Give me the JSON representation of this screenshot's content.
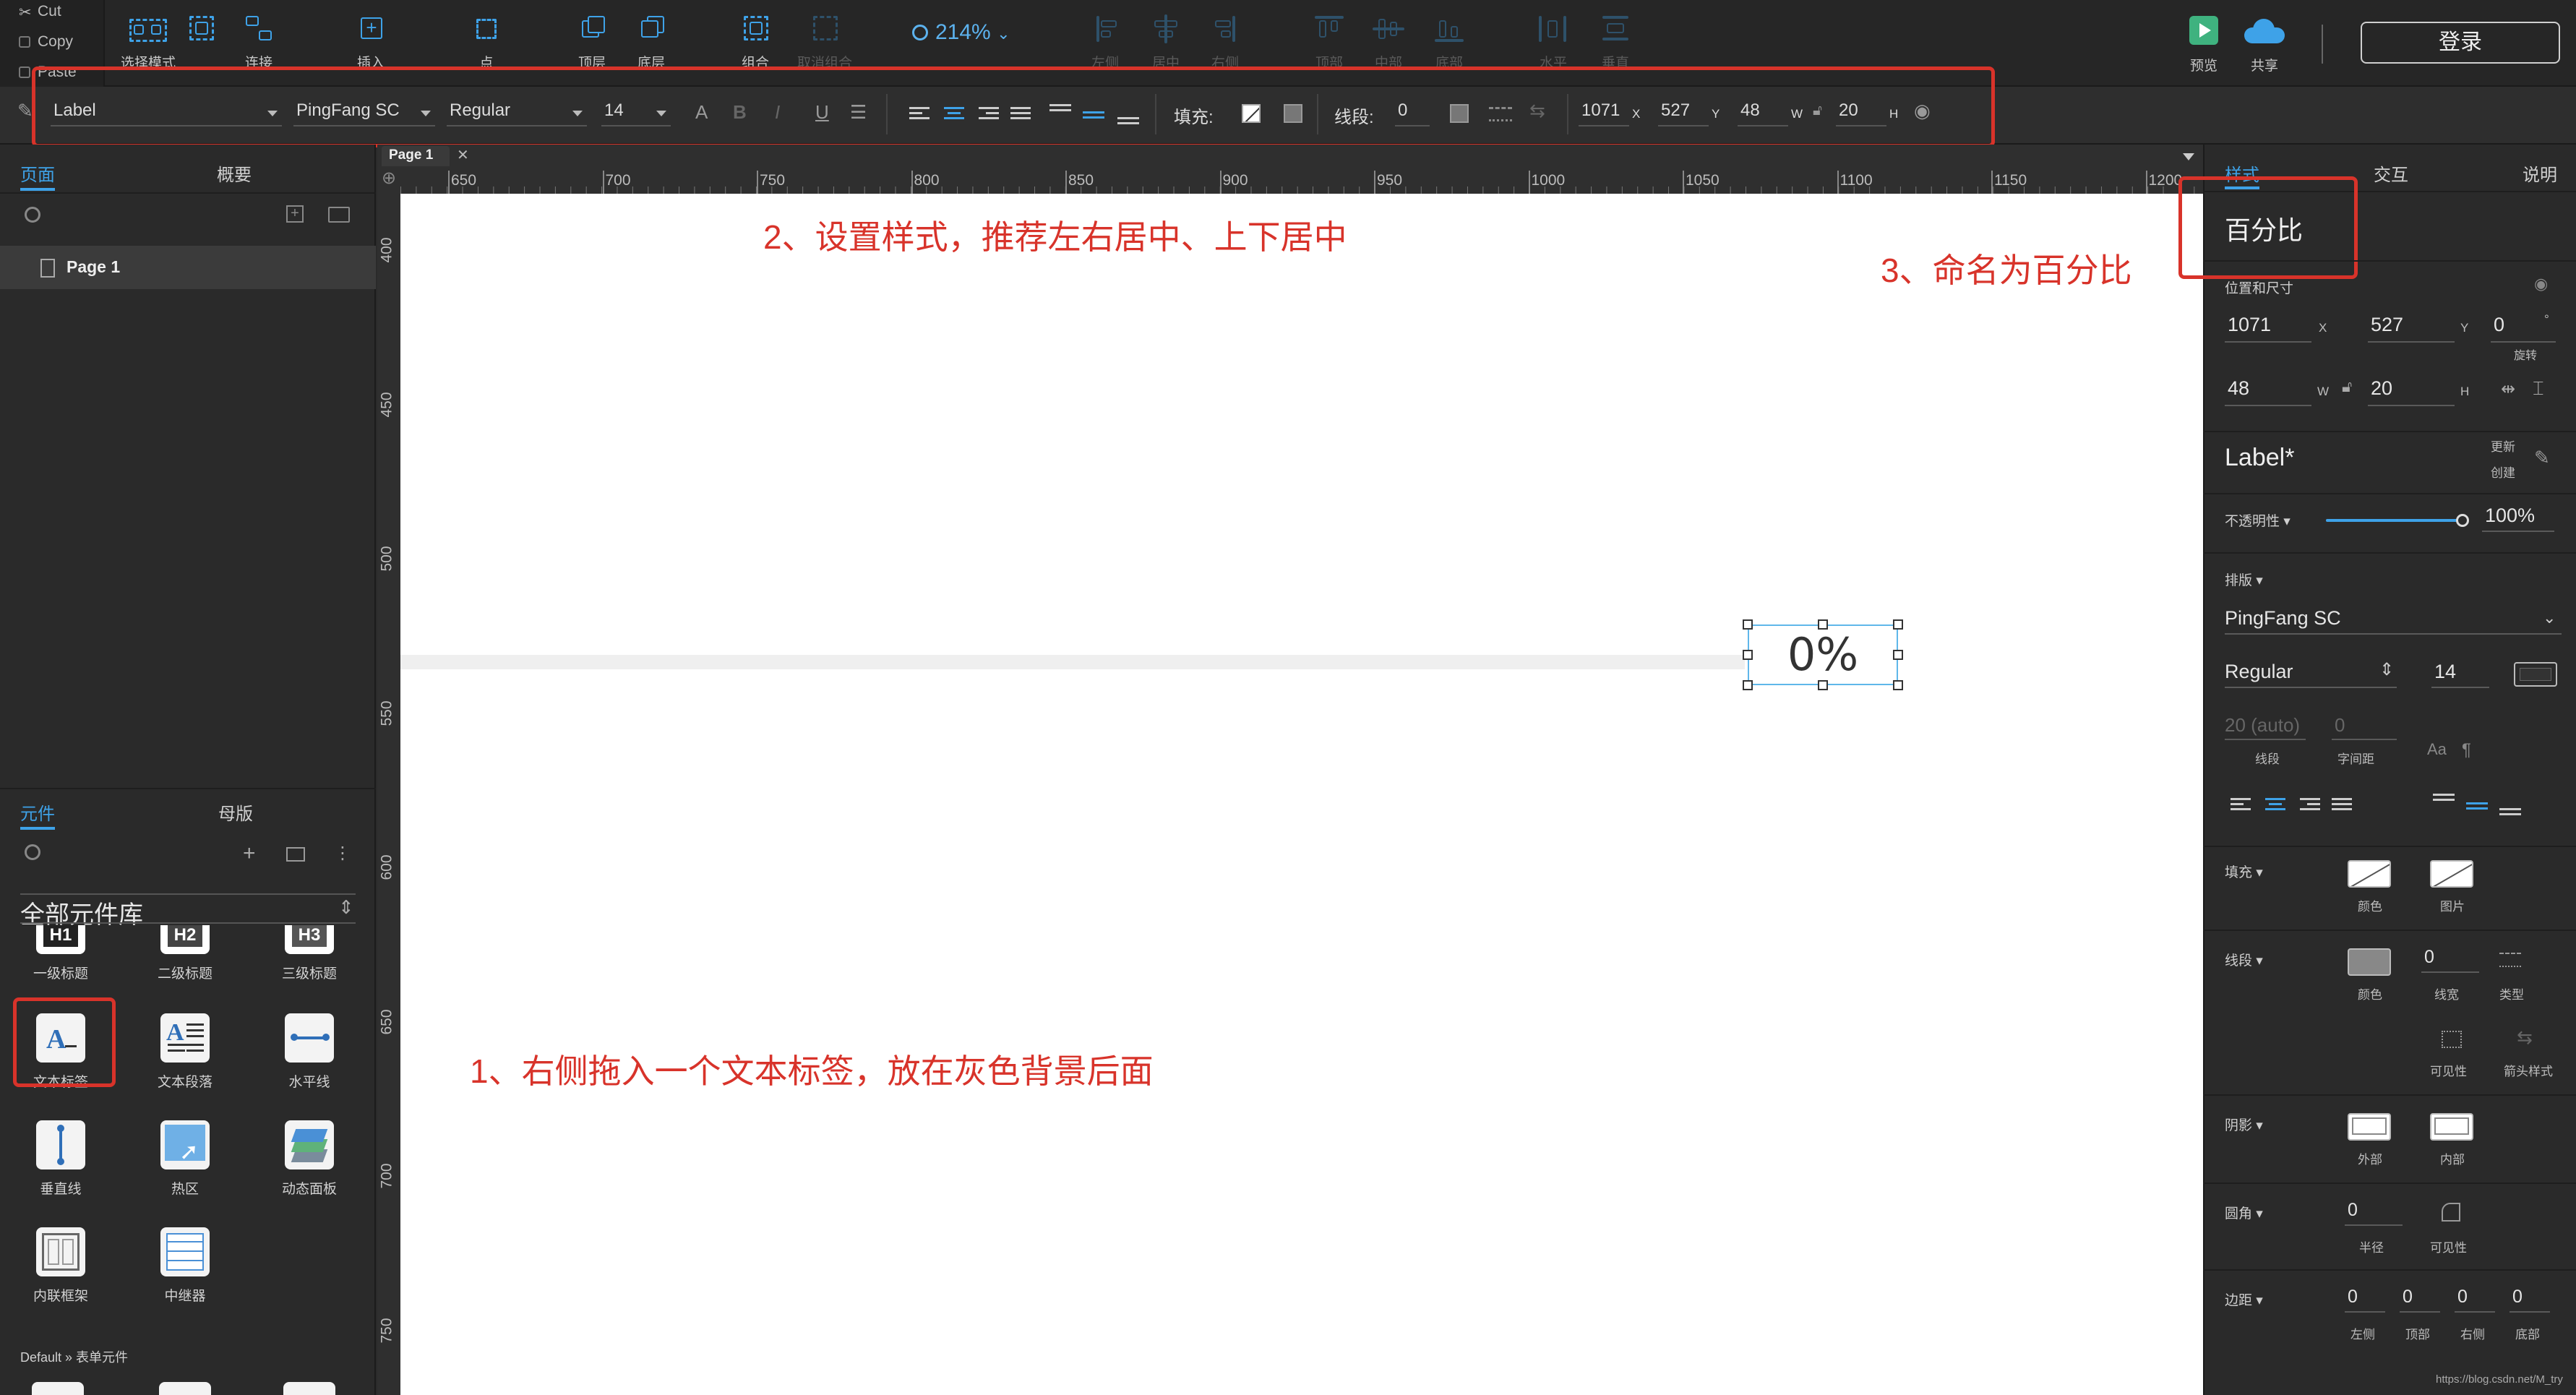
{
  "clipboard": {
    "cut": "Cut",
    "copy": "Copy",
    "paste": "Paste"
  },
  "toolbar": {
    "select_mode": "选择模式",
    "connect": "连接",
    "insert": "插入",
    "point": "点",
    "top_layer": "顶层",
    "bottom_layer": "底层",
    "group": "组合",
    "ungroup": "取消组合",
    "align_left": "左侧",
    "align_center": "居中",
    "align_right": "右侧",
    "align_top": "顶部",
    "align_middle": "中部",
    "align_bottom": "底部",
    "distribute_h": "水平",
    "distribute_v": "垂直",
    "zoom": "214%",
    "preview": "预览",
    "share": "共享",
    "login": "登录"
  },
  "format_bar": {
    "style_name": "Label",
    "font_family": "PingFang SC",
    "font_weight": "Regular",
    "font_size": "14",
    "fill_label": "填充:",
    "stroke_label": "线段:",
    "stroke_value": "0",
    "x": "1071",
    "y": "527",
    "w": "48",
    "h": "20",
    "x_unit": "X",
    "y_unit": "Y",
    "w_unit": "W",
    "h_unit": "H"
  },
  "left_panel": {
    "tabs": [
      "页面",
      "概要"
    ],
    "pages": [
      "Page 1"
    ],
    "lib_tabs": [
      "元件",
      "母版"
    ],
    "library_name": "全部元件库",
    "widgets_row0": [
      "一级标题",
      "二级标题",
      "三级标题"
    ],
    "widgets_row1": [
      "文本标签",
      "文本段落",
      "水平线"
    ],
    "widgets_row2": [
      "垂直线",
      "热区",
      "动态面板"
    ],
    "widgets_row3": [
      "内联框架",
      "中继器"
    ],
    "footer": "Default » 表单元件"
  },
  "canvas": {
    "tab": "Page 1",
    "ruler_top": [
      "650",
      "700",
      "750",
      "800",
      "850",
      "900",
      "950",
      "1000",
      "1050",
      "1100",
      "1150",
      "1200"
    ],
    "ruler_left": [
      "400",
      "450",
      "500",
      "550",
      "600",
      "650",
      "700",
      "750"
    ],
    "label_text": "0%",
    "annotation_1": "1、右侧拖入一个文本标签，放在灰色背景后面",
    "annotation_2": "2、设置样式，推荐左右居中、上下居中",
    "annotation_3": "3、命名为百分比",
    "watermark": "https://blog.csdn.net/M_try"
  },
  "right_panel": {
    "tabs": [
      "样式",
      "交互",
      "说明"
    ],
    "widget_name": "百分比",
    "pos_size_label": "位置和尺寸",
    "x": "1071",
    "y": "527",
    "rotation": "0",
    "rotation_label": "旋转",
    "w": "48",
    "h": "20",
    "x_unit": "X",
    "y_unit": "Y",
    "w_unit": "W",
    "h_unit": "H",
    "degree": "°",
    "style_name": "Label*",
    "update": "更新",
    "create": "创建",
    "opacity_label": "不透明性",
    "opacity_value": "100%",
    "opacity": 1.0,
    "typography_label": "排版",
    "font_family": "PingFang SC",
    "font_weight": "Regular",
    "font_size": "14",
    "line_height": "20 (auto)",
    "letter_spacing": "0",
    "line_height_label": "线段",
    "letter_spacing_label": "字间距",
    "fill_label": "填充",
    "fill_color_label": "颜色",
    "fill_image_label": "图片",
    "stroke_label": "线段",
    "stroke_color_label": "颜色",
    "stroke_width": "0",
    "stroke_width_label": "线宽",
    "stroke_type_label": "类型",
    "visibility_label": "可见性",
    "arrow_label": "箭头样式",
    "shadow_label": "阴影",
    "shadow_outer": "外部",
    "shadow_inner": "内部",
    "radius_label": "圆角",
    "radius_value": "0",
    "radius_sub": "半径",
    "radius_vis": "可见性",
    "padding_label": "边距",
    "padding_values": [
      "0",
      "0",
      "0",
      "0"
    ],
    "padding_labels": [
      "左侧",
      "顶部",
      "右侧",
      "底部"
    ]
  }
}
